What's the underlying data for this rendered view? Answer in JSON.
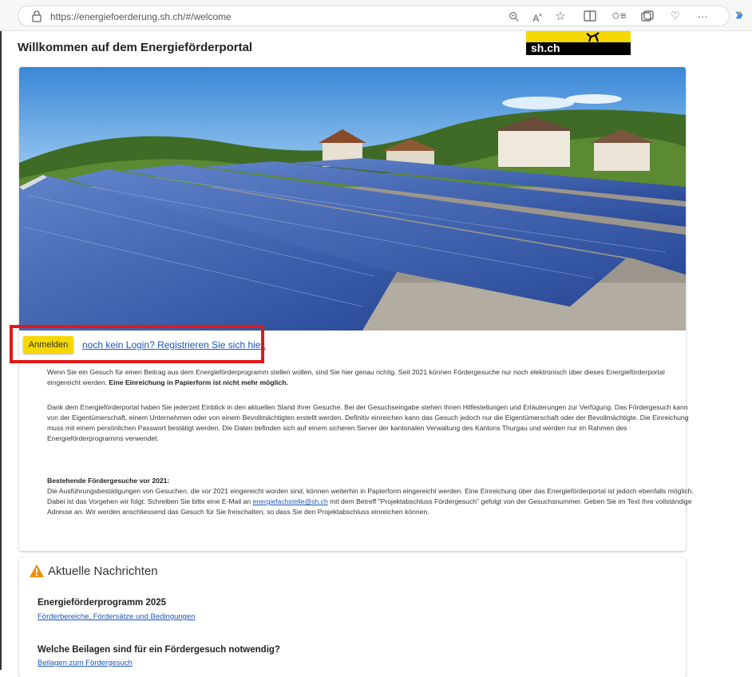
{
  "browser": {
    "url": "https://energiefoerderung.sh.ch/#/welcome",
    "toolbar_icons": [
      "zoom-icon",
      "read-aloud-icon",
      "favorite-icon",
      "split-screen-icon",
      "favorites-list-icon",
      "collections-icon",
      "performance-icon",
      "more-icon",
      "copilot-icon"
    ]
  },
  "header": {
    "title": "Willkommen auf dem Energieförderportal",
    "logo_text": "sh.ch"
  },
  "login": {
    "button_label": "Anmelden",
    "register_link": "noch kein Login? Registrieren Sie sich hier."
  },
  "intro": {
    "p1_text": "Wenn Sie ein Gesuch für einen Beitrag aus dem Energieförderprogramm stellen wollen, sind Sie hier genau richtig. Seit 2021 können Fördergesuche nur noch elektronisch über dieses Energieförderportal eingereicht werden.",
    "p1_bold": "Eine Einreichung in Papierform ist nicht mehr möglich.",
    "p2": "Dank dem Energieförderportal haben Sie jederzeit Einblick in den aktuellen Stand Ihrer Gesuche. Bei der Gesuchseingabe stehen Ihnen Hilfestellungen und Erläuterungen zur Verfügung. Das Fördergesuch kann von der Eigentümerschaft, einem Unternehmen oder von einem Bevollmächtigten erstellt werden. Definitiv einreichen kann das Gesuch jedoch nur die Eigentümerschaft oder der Bevollmächtigte. Die Einreichung muss mit einem persönlichen Passwort bestätigt werden. Die Daten befinden sich auf einem sicheren Server der kantonalen Verwaltung des Kantons Thurgau und werden nur im Rahmen des Energieförderprogramms verwendet.",
    "section_heading": "Bestehende Fördergesuche vor 2021:",
    "p3_before": "Die Ausführungsbestätigungen von Gesuchen, die vor 2021 eingereicht worden sind, können weiterhin in Papierform eingereicht werden. Eine Einreichung über das Energieförderportal ist jedoch ebenfalls möglich. Dabei ist das Vorgehen wir folgt: Schreiben Sie bitte eine E-Mail an",
    "p3_email": "energiefachstelle@sh.ch",
    "p3_after": "mit dem Betreff \"Projektabschluss Fördergesuch\" gefolgt von der Gesuchsnummer. Geben Sie im Text Ihre vollständige Adresse an. Wir werden anschliessend das Gesuch für Sie freischalten, so dass Sie den Projektabschluss einreichen können."
  },
  "news": {
    "heading": "Aktuelle Nachrichten",
    "items": [
      {
        "title": "Energieförderprogramm 2025",
        "link": "Förderbereiche, Fördersätze und Bedingungen"
      },
      {
        "title": "Welche Beilagen sind für ein Fördergesuch notwendig?",
        "link": "Beilagen zum Fördergesuch"
      }
    ]
  },
  "colors": {
    "accent_yellow": "#f5d800",
    "link_blue": "#1a56b8",
    "highlight_red": "#e31818",
    "warning_orange": "#f08c00"
  }
}
